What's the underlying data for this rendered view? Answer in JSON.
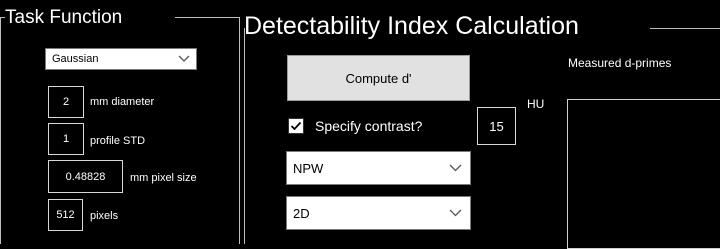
{
  "task_function": {
    "title": "Task Function",
    "type_select": {
      "value": "Gaussian"
    },
    "diameter": {
      "value": "2",
      "label": "mm diameter"
    },
    "profile_std": {
      "value": "1",
      "label": "profile STD"
    },
    "pixel_size": {
      "value": "0.48828",
      "label": "mm pixel size"
    },
    "pixels": {
      "value": "512",
      "label": "pixels"
    }
  },
  "detectability": {
    "title": "Detectability Index Calculation",
    "compute_button": "Compute d'",
    "specify_contrast": {
      "label": "Specify contrast?",
      "checked": true
    },
    "contrast": {
      "value": "15",
      "unit": "HU"
    },
    "observer_select": {
      "value": "NPW"
    },
    "dimension_select": {
      "value": "2D"
    },
    "measured_label": "Measured d-primes"
  }
}
